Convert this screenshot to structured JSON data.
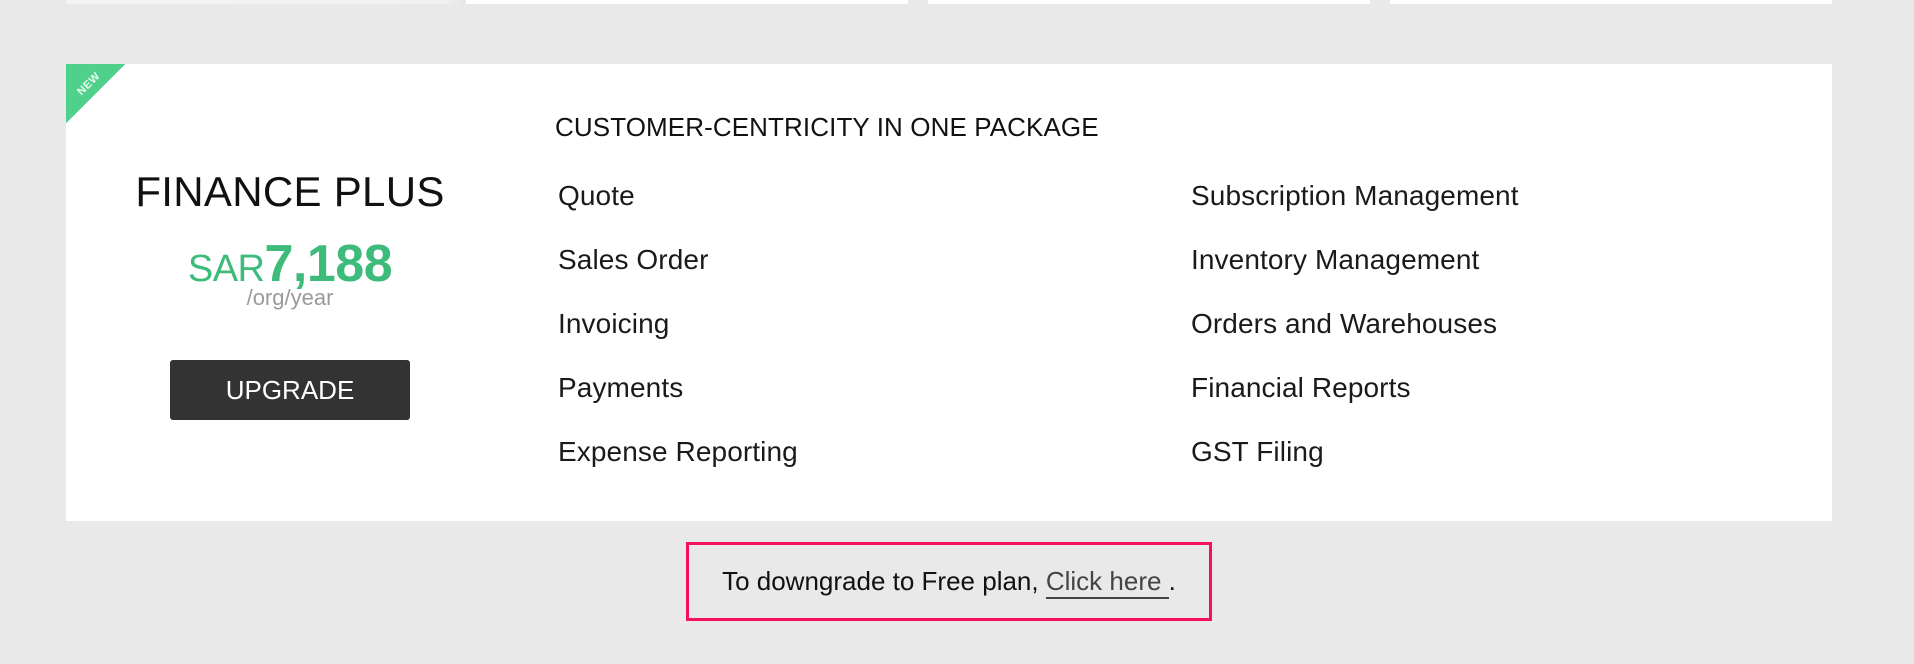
{
  "plan": {
    "badge": "NEW",
    "name": "FINANCE PLUS",
    "currency": "SAR",
    "amount": "7,188",
    "period": "/org/year",
    "upgrade_label": "UPGRADE"
  },
  "features": {
    "heading": "CUSTOMER-CENTRICITY IN ONE PACKAGE",
    "left": [
      "Quote",
      "Sales Order",
      "Invoicing",
      "Payments",
      "Expense Reporting"
    ],
    "right": [
      "Subscription Management",
      "Inventory Management",
      "Orders and Warehouses",
      "Financial Reports",
      "GST Filing"
    ]
  },
  "downgrade": {
    "prefix": "To downgrade to Free plan, ",
    "link_label": "Click here ",
    "suffix": "."
  },
  "colors": {
    "accent_green": "#3dbb7b",
    "badge_green": "#4fd18b",
    "button_dark": "#333333",
    "highlight_border": "#f5115b"
  }
}
